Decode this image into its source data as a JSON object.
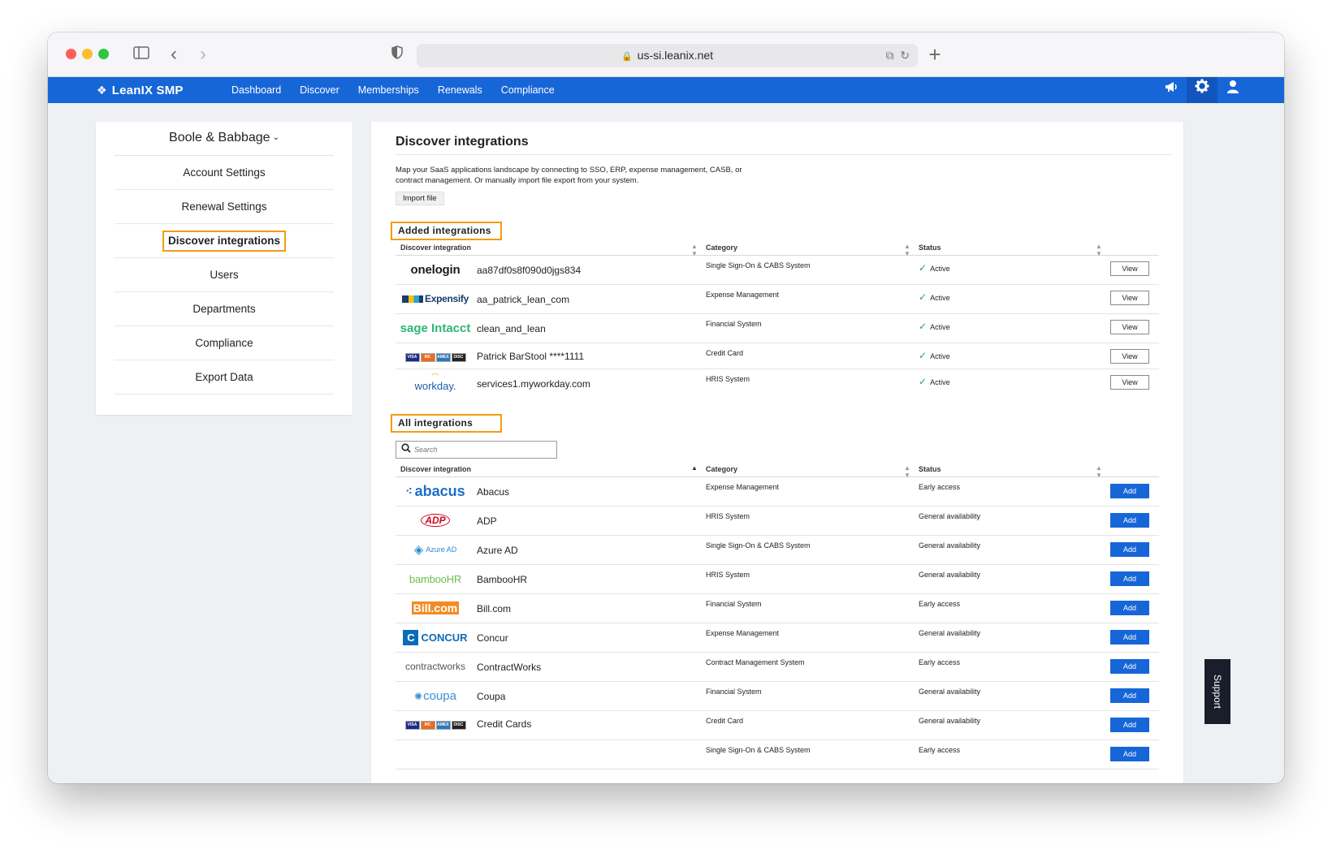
{
  "browser": {
    "url": "us-si.leanix.net",
    "icons": [
      "sidebar-toggle-icon",
      "back-arrow-icon",
      "forward-arrow-icon",
      "shield-icon",
      "lock-icon",
      "translate-icon",
      "reload-icon",
      "new-tab-plus-icon"
    ]
  },
  "appnav": {
    "brand": "LeanIX SMP",
    "links": [
      "Dashboard",
      "Discover",
      "Memberships",
      "Renewals",
      "Compliance"
    ],
    "icons": [
      "megaphone-icon",
      "gear-icon",
      "user-icon"
    ]
  },
  "sidebar": {
    "org": "Boole & Babbage",
    "items": [
      "Account Settings",
      "Renewal Settings",
      "Discover integrations",
      "Users",
      "Departments",
      "Compliance",
      "Export Data"
    ],
    "selected": "Discover integrations"
  },
  "main": {
    "title": "Discover integrations",
    "description": "Map your SaaS applications landscape by connecting to SSO, ERP, expense management, CASB, or contract management. Or manually import file export from your system.",
    "import_label": "Import file",
    "added_label": "Added integrations",
    "all_label": "All integrations",
    "search_placeholder": "Search",
    "columns": {
      "integration": "Discover integration",
      "category": "Category",
      "status": "Status"
    },
    "added": [
      {
        "logo": "onelogin",
        "name": "aa87df0s8f090d0jgs834",
        "category": "Single Sign-On & CABS System",
        "status": "Active",
        "action": "View"
      },
      {
        "logo": "Expensify",
        "name": "aa_patrick_lean_com",
        "category": "Expense Management",
        "status": "Active",
        "action": "View"
      },
      {
        "logo": "sage Intacct",
        "name": "clean_and_lean",
        "category": "Financial System",
        "status": "Active",
        "action": "View"
      },
      {
        "logo": "credit-cards",
        "name": "Patrick BarStool ****1111",
        "category": "Credit Card",
        "status": "Active",
        "action": "View"
      },
      {
        "logo": "workday.",
        "name": "services1.myworkday.com",
        "category": "HRIS System",
        "status": "Active",
        "action": "View"
      }
    ],
    "all": [
      {
        "logo": "abacus",
        "name": "Abacus",
        "category": "Expense Management",
        "status": "Early access",
        "action": "Add"
      },
      {
        "logo": "ADP",
        "name": "ADP",
        "category": "HRIS System",
        "status": "General availability",
        "action": "Add"
      },
      {
        "logo": "Azure AD",
        "name": "Azure AD",
        "category": "Single Sign-On & CABS System",
        "status": "General availability",
        "action": "Add"
      },
      {
        "logo": "bambooHR",
        "name": "BambooHR",
        "category": "HRIS System",
        "status": "General availability",
        "action": "Add"
      },
      {
        "logo": "Bill.com",
        "name": "Bill.com",
        "category": "Financial System",
        "status": "Early access",
        "action": "Add"
      },
      {
        "logo": "CONCUR",
        "name": "Concur",
        "category": "Expense Management",
        "status": "General availability",
        "action": "Add"
      },
      {
        "logo": "contractworks",
        "name": "ContractWorks",
        "category": "Contract Management System",
        "status": "Early access",
        "action": "Add"
      },
      {
        "logo": "coupa",
        "name": "Coupa",
        "category": "Financial System",
        "status": "General availability",
        "action": "Add"
      },
      {
        "logo": "credit-cards",
        "name": "Credit Cards",
        "category": "Credit Card",
        "status": "General availability",
        "action": "Add"
      },
      {
        "logo": "",
        "name": "",
        "category": "Single Sign-On & CABS System",
        "status": "Early access",
        "action": "Add"
      }
    ]
  },
  "support_label": "Support",
  "colors": {
    "brand_blue": "#1766d8",
    "highlight_orange": "#f39c12",
    "active_green": "#2ba84a"
  }
}
